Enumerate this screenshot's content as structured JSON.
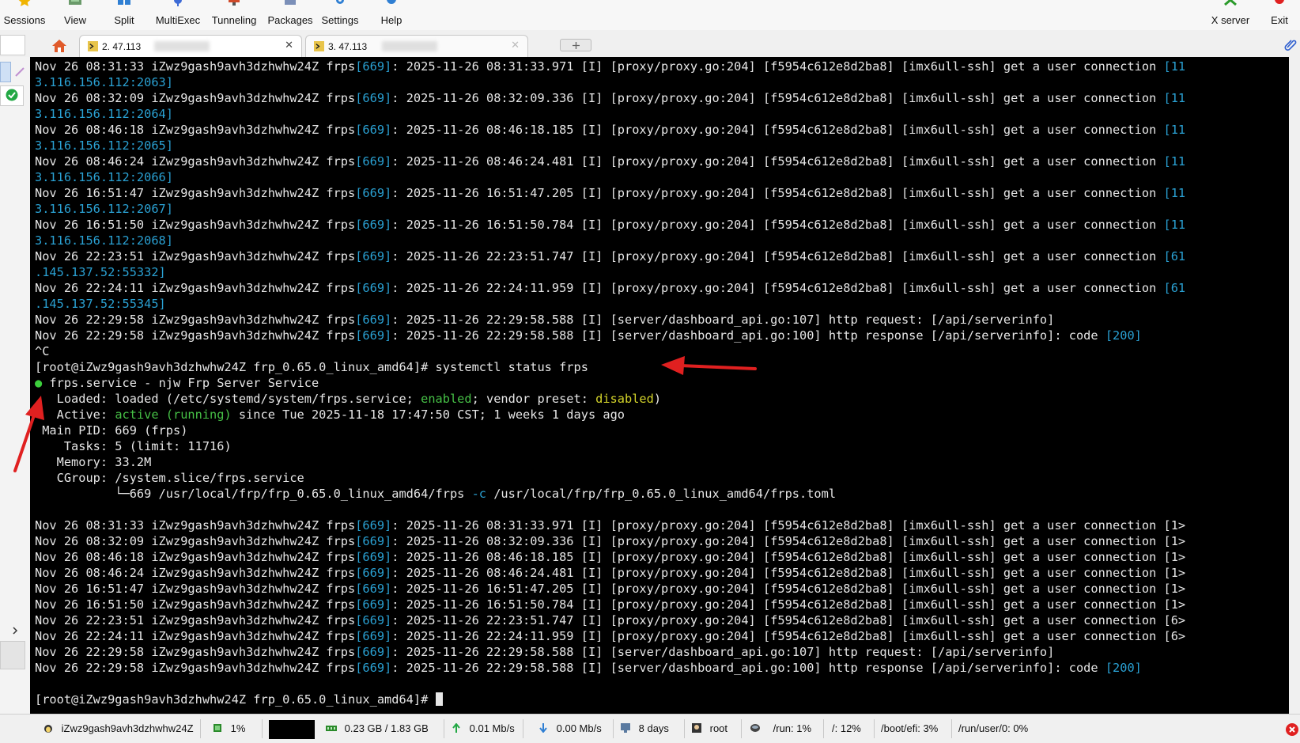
{
  "toolbar": {
    "items": [
      {
        "label": "Sessions",
        "icon": "star-icon",
        "color": "#f0b400"
      },
      {
        "label": "View",
        "icon": "view-icon",
        "color": "#3b7a3b"
      },
      {
        "label": "Split",
        "icon": "split-icon",
        "color": "#2f7fd3"
      },
      {
        "label": "MultiExec",
        "icon": "multiexec-icon",
        "color": "#3e6bd6"
      },
      {
        "label": "Tunneling",
        "icon": "tunneling-icon",
        "color": "#d04a2a"
      },
      {
        "label": "Packages",
        "icon": "packages-icon",
        "color": "#7b8fb8"
      },
      {
        "label": "Settings",
        "icon": "gear-icon",
        "color": "#2f7fd3"
      },
      {
        "label": "Help",
        "icon": "help-icon",
        "color": "#2f7fd3"
      }
    ],
    "xserver_label": "X server",
    "exit_label": "Exit"
  },
  "tabs": [
    {
      "label": "2. 47.113",
      "close": "✕",
      "active": true
    },
    {
      "label": "3. 47.113",
      "close": "✕",
      "active": false
    }
  ],
  "terminal": {
    "lines": [
      [
        {
          "t": "Nov 26 08:31:33 iZwz9gash9avh3dzhwhw24Z frps"
        },
        {
          "t": "[669]",
          "c": "c"
        },
        {
          "t": ": 2025-11-26 08:31:33.971 [I] [proxy/proxy.go:204] [f5954c612e8d2ba8] [imx6ull-ssh] get a user connection "
        },
        {
          "t": "[11",
          "c": "c"
        }
      ],
      [
        {
          "t": "3.116.156.112:2063]",
          "c": "c"
        }
      ],
      [
        {
          "t": "Nov 26 08:32:09 iZwz9gash9avh3dzhwhw24Z frps"
        },
        {
          "t": "[669]",
          "c": "c"
        },
        {
          "t": ": 2025-11-26 08:32:09.336 [I] [proxy/proxy.go:204] [f5954c612e8d2ba8] [imx6ull-ssh] get a user connection "
        },
        {
          "t": "[11",
          "c": "c"
        }
      ],
      [
        {
          "t": "3.116.156.112:2064]",
          "c": "c"
        }
      ],
      [
        {
          "t": "Nov 26 08:46:18 iZwz9gash9avh3dzhwhw24Z frps"
        },
        {
          "t": "[669]",
          "c": "c"
        },
        {
          "t": ": 2025-11-26 08:46:18.185 [I] [proxy/proxy.go:204] [f5954c612e8d2ba8] [imx6ull-ssh] get a user connection "
        },
        {
          "t": "[11",
          "c": "c"
        }
      ],
      [
        {
          "t": "3.116.156.112:2065]",
          "c": "c"
        }
      ],
      [
        {
          "t": "Nov 26 08:46:24 iZwz9gash9avh3dzhwhw24Z frps"
        },
        {
          "t": "[669]",
          "c": "c"
        },
        {
          "t": ": 2025-11-26 08:46:24.481 [I] [proxy/proxy.go:204] [f5954c612e8d2ba8] [imx6ull-ssh] get a user connection "
        },
        {
          "t": "[11",
          "c": "c"
        }
      ],
      [
        {
          "t": "3.116.156.112:2066]",
          "c": "c"
        }
      ],
      [
        {
          "t": "Nov 26 16:51:47 iZwz9gash9avh3dzhwhw24Z frps"
        },
        {
          "t": "[669]",
          "c": "c"
        },
        {
          "t": ": 2025-11-26 16:51:47.205 [I] [proxy/proxy.go:204] [f5954c612e8d2ba8] [imx6ull-ssh] get a user connection "
        },
        {
          "t": "[11",
          "c": "c"
        }
      ],
      [
        {
          "t": "3.116.156.112:2067]",
          "c": "c"
        }
      ],
      [
        {
          "t": "Nov 26 16:51:50 iZwz9gash9avh3dzhwhw24Z frps"
        },
        {
          "t": "[669]",
          "c": "c"
        },
        {
          "t": ": 2025-11-26 16:51:50.784 [I] [proxy/proxy.go:204] [f5954c612e8d2ba8] [imx6ull-ssh] get a user connection "
        },
        {
          "t": "[11",
          "c": "c"
        }
      ],
      [
        {
          "t": "3.116.156.112:2068]",
          "c": "c"
        }
      ],
      [
        {
          "t": "Nov 26 22:23:51 iZwz9gash9avh3dzhwhw24Z frps"
        },
        {
          "t": "[669]",
          "c": "c"
        },
        {
          "t": ": 2025-11-26 22:23:51.747 [I] [proxy/proxy.go:204] [f5954c612e8d2ba8] [imx6ull-ssh] get a user connection "
        },
        {
          "t": "[61",
          "c": "c"
        }
      ],
      [
        {
          "t": ".145.137.52:55332]",
          "c": "c"
        }
      ],
      [
        {
          "t": "Nov 26 22:24:11 iZwz9gash9avh3dzhwhw24Z frps"
        },
        {
          "t": "[669]",
          "c": "c"
        },
        {
          "t": ": 2025-11-26 22:24:11.959 [I] [proxy/proxy.go:204] [f5954c612e8d2ba8] [imx6ull-ssh] get a user connection "
        },
        {
          "t": "[61",
          "c": "c"
        }
      ],
      [
        {
          "t": ".145.137.52:55345]",
          "c": "c"
        }
      ],
      [
        {
          "t": "Nov 26 22:29:58 iZwz9gash9avh3dzhwhw24Z frps"
        },
        {
          "t": "[669]",
          "c": "c"
        },
        {
          "t": ": 2025-11-26 22:29:58.588 [I] [server/dashboard_api.go:107] http request: [/api/serverinfo]"
        }
      ],
      [
        {
          "t": "Nov 26 22:29:58 iZwz9gash9avh3dzhwhw24Z frps"
        },
        {
          "t": "[669]",
          "c": "c"
        },
        {
          "t": ": 2025-11-26 22:29:58.588 [I] [server/dashboard_api.go:100] http response [/api/serverinfo]: code "
        },
        {
          "t": "[200]",
          "c": "c"
        }
      ],
      [
        {
          "t": "^C"
        }
      ],
      [
        {
          "t": "[root@iZwz9gash9avh3dzhwhw24Z frp_0.65.0_linux_amd64]# systemctl status frps"
        }
      ],
      [
        {
          "t": "●",
          "c": "dot"
        },
        {
          "t": " frps.service - njw Frp Server Service"
        }
      ],
      [
        {
          "t": "   Loaded: loaded (/etc/systemd/system/frps.service; "
        },
        {
          "t": "enabled",
          "c": "g"
        },
        {
          "t": "; vendor preset: "
        },
        {
          "t": "disabled",
          "c": "y"
        },
        {
          "t": ")"
        }
      ],
      [
        {
          "t": "   Active: "
        },
        {
          "t": "active (running)",
          "c": "g"
        },
        {
          "t": " since Tue 2025-11-18 17:47:50 CST; 1 weeks 1 days ago"
        }
      ],
      [
        {
          "t": " Main PID: 669 (frps)"
        }
      ],
      [
        {
          "t": "    Tasks: 5 (limit: 11716)"
        }
      ],
      [
        {
          "t": "   Memory: 33.2M"
        }
      ],
      [
        {
          "t": "   CGroup: /system.slice/frps.service"
        }
      ],
      [
        {
          "t": "           └─669 /usr/local/frp/frp_0.65.0_linux_amd64/frps "
        },
        {
          "t": "-c",
          "c": "c"
        },
        {
          "t": " /usr/local/frp/frp_0.65.0_linux_amd64/frps.toml"
        }
      ],
      [
        {
          "t": " "
        }
      ],
      [
        {
          "t": "Nov 26 08:31:33 iZwz9gash9avh3dzhwhw24Z frps"
        },
        {
          "t": "[669]",
          "c": "c"
        },
        {
          "t": ": 2025-11-26 08:31:33.971 [I] [proxy/proxy.go:204] [f5954c612e8d2ba8] [imx6ull-ssh] get a user connection [1>"
        }
      ],
      [
        {
          "t": "Nov 26 08:32:09 iZwz9gash9avh3dzhwhw24Z frps"
        },
        {
          "t": "[669]",
          "c": "c"
        },
        {
          "t": ": 2025-11-26 08:32:09.336 [I] [proxy/proxy.go:204] [f5954c612e8d2ba8] [imx6ull-ssh] get a user connection [1>"
        }
      ],
      [
        {
          "t": "Nov 26 08:46:18 iZwz9gash9avh3dzhwhw24Z frps"
        },
        {
          "t": "[669]",
          "c": "c"
        },
        {
          "t": ": 2025-11-26 08:46:18.185 [I] [proxy/proxy.go:204] [f5954c612e8d2ba8] [imx6ull-ssh] get a user connection [1>"
        }
      ],
      [
        {
          "t": "Nov 26 08:46:24 iZwz9gash9avh3dzhwhw24Z frps"
        },
        {
          "t": "[669]",
          "c": "c"
        },
        {
          "t": ": 2025-11-26 08:46:24.481 [I] [proxy/proxy.go:204] [f5954c612e8d2ba8] [imx6ull-ssh] get a user connection [1>"
        }
      ],
      [
        {
          "t": "Nov 26 16:51:47 iZwz9gash9avh3dzhwhw24Z frps"
        },
        {
          "t": "[669]",
          "c": "c"
        },
        {
          "t": ": 2025-11-26 16:51:47.205 [I] [proxy/proxy.go:204] [f5954c612e8d2ba8] [imx6ull-ssh] get a user connection [1>"
        }
      ],
      [
        {
          "t": "Nov 26 16:51:50 iZwz9gash9avh3dzhwhw24Z frps"
        },
        {
          "t": "[669]",
          "c": "c"
        },
        {
          "t": ": 2025-11-26 16:51:50.784 [I] [proxy/proxy.go:204] [f5954c612e8d2ba8] [imx6ull-ssh] get a user connection [1>"
        }
      ],
      [
        {
          "t": "Nov 26 22:23:51 iZwz9gash9avh3dzhwhw24Z frps"
        },
        {
          "t": "[669]",
          "c": "c"
        },
        {
          "t": ": 2025-11-26 22:23:51.747 [I] [proxy/proxy.go:204] [f5954c612e8d2ba8] [imx6ull-ssh] get a user connection [6>"
        }
      ],
      [
        {
          "t": "Nov 26 22:24:11 iZwz9gash9avh3dzhwhw24Z frps"
        },
        {
          "t": "[669]",
          "c": "c"
        },
        {
          "t": ": 2025-11-26 22:24:11.959 [I] [proxy/proxy.go:204] [f5954c612e8d2ba8] [imx6ull-ssh] get a user connection [6>"
        }
      ],
      [
        {
          "t": "Nov 26 22:29:58 iZwz9gash9avh3dzhwhw24Z frps"
        },
        {
          "t": "[669]",
          "c": "c"
        },
        {
          "t": ": 2025-11-26 22:29:58.588 [I] [server/dashboard_api.go:107] http request: [/api/serverinfo]"
        }
      ],
      [
        {
          "t": "Nov 26 22:29:58 iZwz9gash9avh3dzhwhw24Z frps"
        },
        {
          "t": "[669]",
          "c": "c"
        },
        {
          "t": ": 2025-11-26 22:29:58.588 [I] [server/dashboard_api.go:100] http response [/api/serverinfo]: code "
        },
        {
          "t": "[200]",
          "c": "c"
        }
      ],
      [
        {
          "t": " "
        }
      ],
      [
        {
          "t": "[root@iZwz9gash9avh3dzhwhw24Z frp_0.65.0_linux_amd64]# "
        },
        {
          "t": "",
          "c": "cursor"
        }
      ]
    ]
  },
  "statusbar": {
    "host": "iZwz9gash9avh3dzhwhw24Z",
    "cpu": "1%",
    "memory": "0.23 GB / 1.83 GB",
    "upload": "0.01 Mb/s",
    "download": "0.00 Mb/s",
    "uptime": "8 days",
    "user": "root",
    "disk_run": "/run: 1%",
    "disk_root": "/: 12%",
    "disk_boot": "/boot/efi: 3%",
    "disk_user": "/run/user/0: 0%"
  },
  "colors": {
    "terminal_bg": "#000000",
    "terminal_fg": "#e6e6e6",
    "cyan": "#2aa1d3",
    "green": "#46c046",
    "yellow": "#d3d32a",
    "annotation_arrow": "#e02020"
  }
}
